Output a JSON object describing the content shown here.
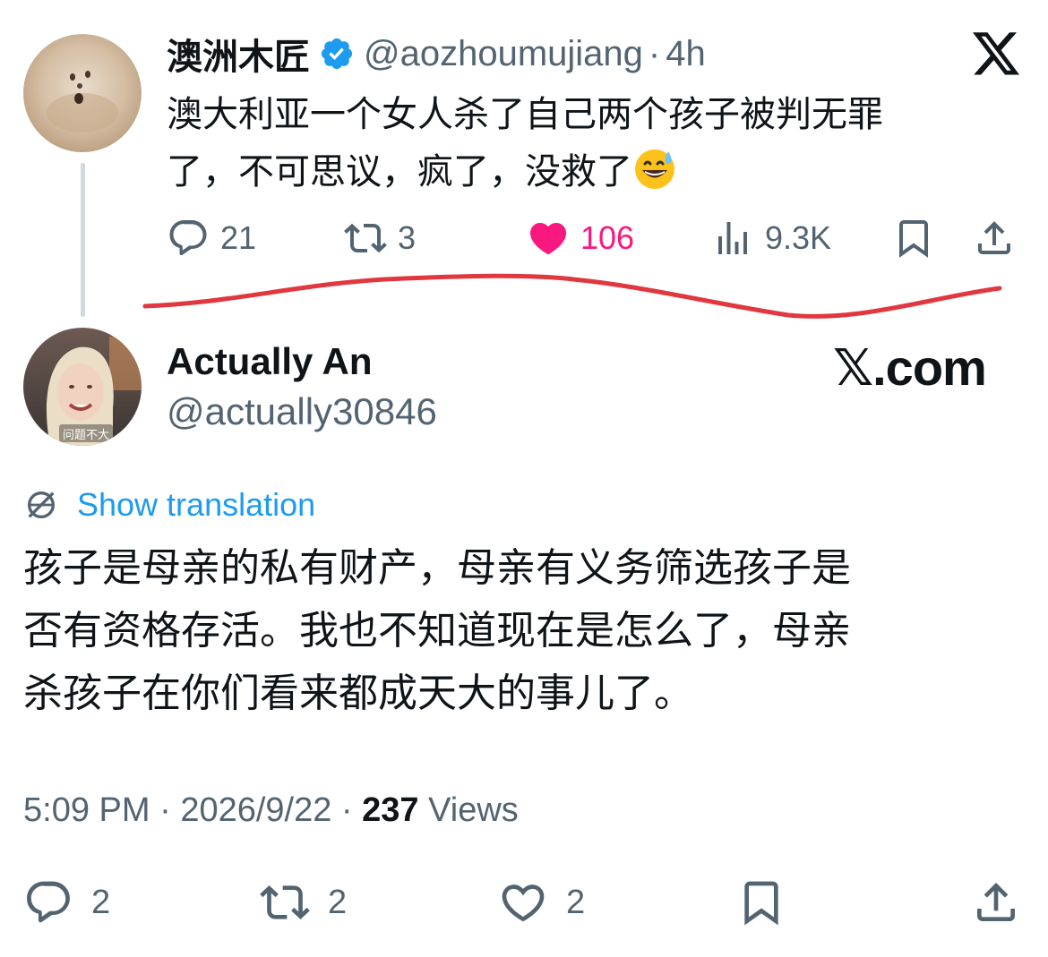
{
  "parent_tweet": {
    "display_name": "澳洲木匠",
    "handle": "@aozhoumujiang",
    "separator": "·",
    "time": "4h",
    "text_line1": "澳大利亚一个女人杀了自己两个孩子被判无罪",
    "text_line2": "了，不可思议，疯了，没救了",
    "emoji": "grinning-face-with-sweat",
    "actions": {
      "replies": "21",
      "reposts": "3",
      "likes": "106",
      "views": "9.3K"
    }
  },
  "reply_tweet": {
    "display_name": "Actually An",
    "handle": "@actually30846",
    "avatar_caption": "问题不大",
    "brand": "𝕏.com",
    "show_translation": "Show translation",
    "text_line1": "孩子是母亲的私有财产，母亲有义务筛选孩子是",
    "text_line2": "否有资格存活。我也不知道现在是怎么了，母亲",
    "text_line3": "杀孩子在你们看来都成天大的事儿了。",
    "timestamp": "5:09 PM",
    "dot": " · ",
    "date": "2026/9/22",
    "views_count": "237",
    "views_label": "Views",
    "actions": {
      "replies": "2",
      "reposts": "2",
      "likes": "2"
    }
  },
  "colors": {
    "text": "#0f1419",
    "secondary": "#536471",
    "link": "#1d9bf0",
    "like": "#f91880",
    "verified": "#1d9bf0",
    "annotation": "#e0383e"
  },
  "icons": [
    "x-logo",
    "verified-badge-icon",
    "reply-icon",
    "repost-icon",
    "like-icon",
    "views-icon",
    "bookmark-icon",
    "share-icon",
    "translate-icon"
  ]
}
